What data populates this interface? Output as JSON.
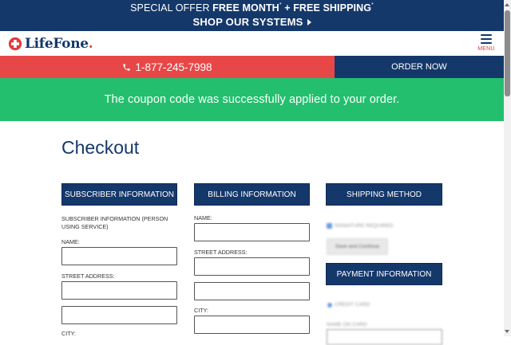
{
  "promo": {
    "prefix": "SPECIAL OFFER ",
    "free_month": "FREE MONTH",
    "sup1": "*",
    "plus": " + ",
    "free_shipping": "FREE SHIPPING",
    "sup2": "*",
    "shop_link": "SHOP OUR SYSTEMS"
  },
  "header": {
    "logo_text": "LifeFone",
    "logo_dot": ".",
    "menu_label": "MENU",
    "brand_colors": {
      "navy": "#15386a",
      "red": "#e03c3c"
    }
  },
  "actions": {
    "phone": "1-877-245-7998",
    "order": "ORDER NOW"
  },
  "alert": {
    "message": "The coupon code was successfully applied to your order.",
    "color": "#23bf6e"
  },
  "page": {
    "title": "Checkout"
  },
  "subscriber": {
    "heading": "SUBSCRIBER INFORMATION",
    "note": "SUBSCRIBER INFORMATION (PERSON USING SERVICE)",
    "name_label": "NAME:",
    "name_value": "",
    "street_label": "STREET ADDRESS:",
    "street_value": "",
    "street2_value": "",
    "city_label": "CITY:"
  },
  "billing": {
    "heading": "BILLING INFORMATION",
    "name_label": "NAME:",
    "name_value": "",
    "street_label": "STREET ADDRESS:",
    "street_value": "",
    "street2_value": "",
    "city_label": "CITY:",
    "city_value": ""
  },
  "shipping": {
    "heading": "SHIPPING METHOD",
    "signature_label": "SIGNATURE REQUIRED",
    "save_button": "Save and Continue"
  },
  "payment": {
    "heading": "PAYMENT INFORMATION",
    "credit_card_label": "CREDIT CARD",
    "name_on_card_label": "NAME ON CARD"
  }
}
